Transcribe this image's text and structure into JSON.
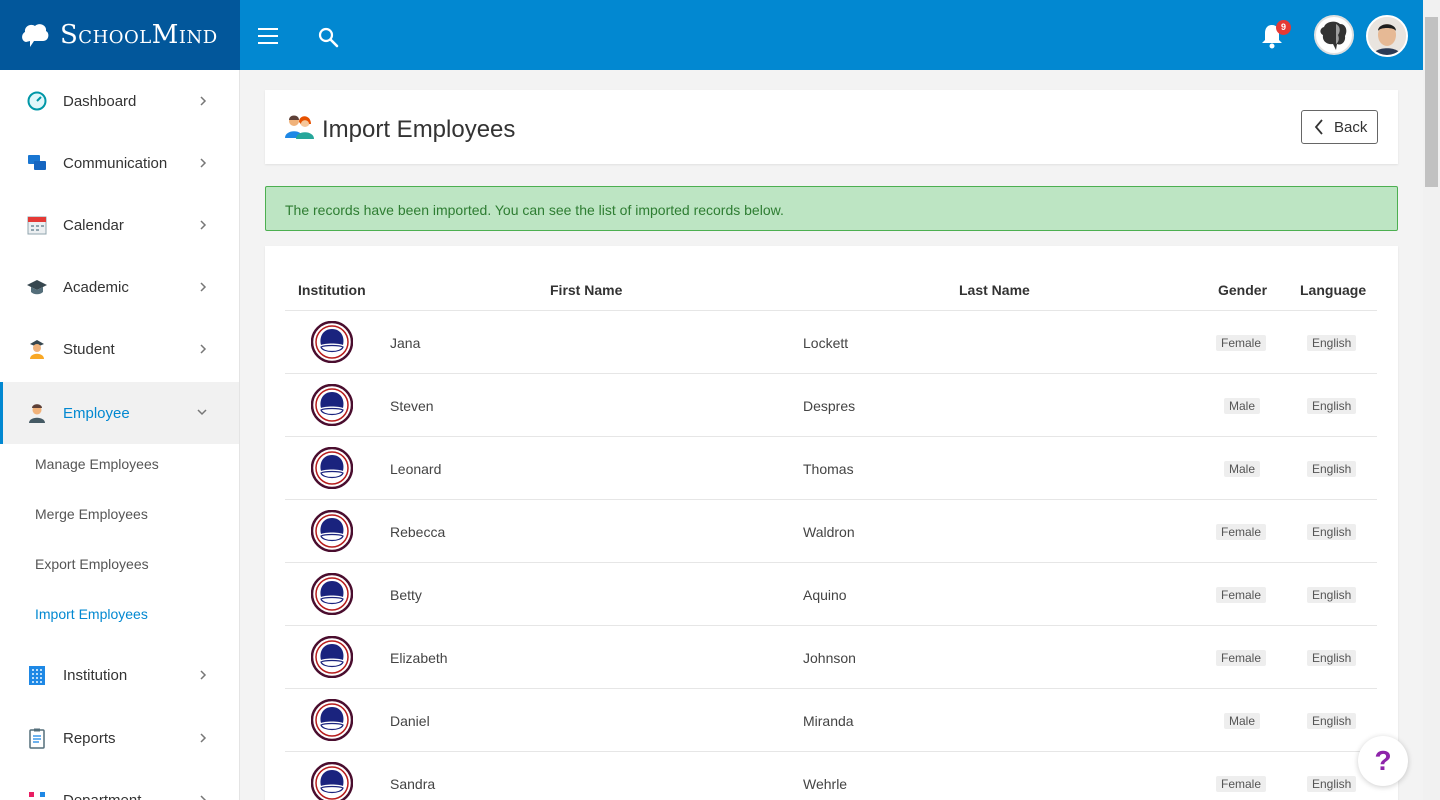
{
  "brand": {
    "name": "SchoolMind"
  },
  "header": {
    "notification_count": "9"
  },
  "sidebar": {
    "items": [
      {
        "label": "Dashboard",
        "icon": "dashboard-gauge-icon"
      },
      {
        "label": "Communication",
        "icon": "chat-bubbles-icon"
      },
      {
        "label": "Calendar",
        "icon": "calendar-icon"
      },
      {
        "label": "Academic",
        "icon": "graduation-cap-icon"
      },
      {
        "label": "Student",
        "icon": "student-icon"
      },
      {
        "label": "Employee",
        "icon": "employee-icon"
      },
      {
        "label": "Institution",
        "icon": "building-grid-icon"
      },
      {
        "label": "Reports",
        "icon": "clipboard-icon"
      },
      {
        "label": "Department",
        "icon": "department-icon"
      }
    ],
    "employee_sub": [
      "Manage Employees",
      "Merge Employees",
      "Export Employees",
      "Import Employees"
    ]
  },
  "page": {
    "title": "Import Employees",
    "back_label": "Back"
  },
  "alert": {
    "message": "The records have been imported. You can see the list of imported records below."
  },
  "table": {
    "headers": [
      "Institution",
      "First Name",
      "Last Name",
      "Gender",
      "Language"
    ],
    "rows": [
      {
        "first": "Jana",
        "last": "Lockett",
        "gender": "Female",
        "language": "English"
      },
      {
        "first": "Steven",
        "last": "Despres",
        "gender": "Male",
        "language": "English"
      },
      {
        "first": "Leonard",
        "last": "Thomas",
        "gender": "Male",
        "language": "English"
      },
      {
        "first": "Rebecca",
        "last": "Waldron",
        "gender": "Female",
        "language": "English"
      },
      {
        "first": "Betty",
        "last": "Aquino",
        "gender": "Female",
        "language": "English"
      },
      {
        "first": "Elizabeth",
        "last": "Johnson",
        "gender": "Female",
        "language": "English"
      },
      {
        "first": "Daniel",
        "last": "Miranda",
        "gender": "Male",
        "language": "English"
      },
      {
        "first": "Sandra",
        "last": "Wehrle",
        "gender": "Female",
        "language": "English"
      }
    ]
  },
  "help": {
    "label": "?"
  },
  "colors": {
    "primary": "#0288d1",
    "brand_dark": "#02579b",
    "alert_bg": "#bde5c3",
    "alert_text": "#2e7d32"
  }
}
